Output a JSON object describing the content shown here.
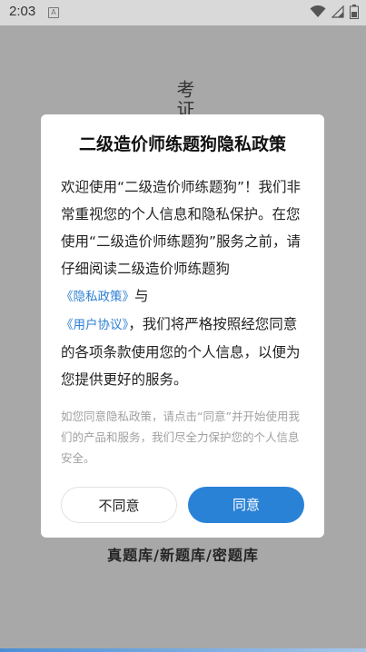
{
  "status_bar": {
    "time": "2:03",
    "app_icon_letter": "A",
    "icons": [
      "wifi-icon",
      "signal-icon",
      "battery-icon"
    ]
  },
  "background": {
    "logo_partial": "考证",
    "tagline": "真题库/新题库/密题库"
  },
  "dialog": {
    "title": "二级造价师练题狗隐私政策",
    "body_part1": "欢迎使用“二级造价师练题狗”！我们非常重视您的个人信息和隐私保护。在您使用“二级造价师练题狗”服务之前，请仔细阅读二级造价师练题狗",
    "privacy_link": "《隐私政策》",
    "body_and": "与",
    "agreement_link": "《用户协议》",
    "body_part2": "，我们将严格按照经您同意的各项条款使用您的个人信息，以便为您提供更好的服务。",
    "note": "如您同意隐私政策，请点击“同意”并开始使用我们的产品和服务，我们尽全力保护您的个人信息安全。",
    "disagree_label": "不同意",
    "agree_label": "同意"
  },
  "colors": {
    "accent": "#2a82d7",
    "link": "#2c7fd3"
  }
}
